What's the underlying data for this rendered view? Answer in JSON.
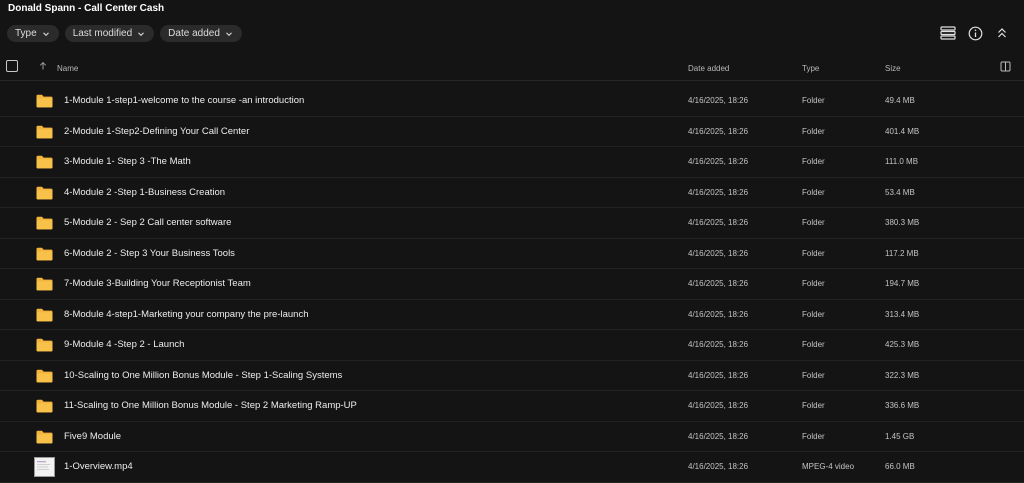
{
  "window": {
    "title": "Donald Spann - Call Center Cash"
  },
  "filters": [
    {
      "label": "Type"
    },
    {
      "label": "Last modified"
    },
    {
      "label": "Date added"
    }
  ],
  "toolbar": {
    "icons": [
      "list-view-icon",
      "info-icon",
      "collapse-icon"
    ]
  },
  "table": {
    "columns": {
      "name": "Name",
      "date": "Date added",
      "type": "Type",
      "size": "Size"
    },
    "sort": {
      "column": "name",
      "direction": "ascending"
    },
    "rows": [
      {
        "icon": "folder-icon",
        "name": "1-Module 1-step1-welcome to the course -an introduction",
        "date": "4/16/2025, 18:26",
        "type": "Folder",
        "size": "49.4 MB"
      },
      {
        "icon": "folder-icon",
        "name": "2-Module 1-Step2-Defining Your Call Center",
        "date": "4/16/2025, 18:26",
        "type": "Folder",
        "size": "401.4 MB"
      },
      {
        "icon": "folder-icon",
        "name": "3-Module 1- Step 3 -The Math",
        "date": "4/16/2025, 18:26",
        "type": "Folder",
        "size": "111.0 MB"
      },
      {
        "icon": "folder-icon",
        "name": "4-Module 2 -Step 1-Business Creation",
        "date": "4/16/2025, 18:26",
        "type": "Folder",
        "size": "53.4 MB"
      },
      {
        "icon": "folder-icon",
        "name": "5-Module 2 - Sep 2 Call center software",
        "date": "4/16/2025, 18:26",
        "type": "Folder",
        "size": "380.3 MB"
      },
      {
        "icon": "folder-icon",
        "name": "6-Module 2 - Step 3 Your Business Tools",
        "date": "4/16/2025, 18:26",
        "type": "Folder",
        "size": "117.2 MB"
      },
      {
        "icon": "folder-icon",
        "name": "7-Module 3-Building Your Receptionist Team",
        "date": "4/16/2025, 18:26",
        "type": "Folder",
        "size": "194.7 MB"
      },
      {
        "icon": "folder-icon",
        "name": "8-Module 4-step1-Marketing your company the pre-launch",
        "date": "4/16/2025, 18:26",
        "type": "Folder",
        "size": "313.4 MB"
      },
      {
        "icon": "folder-icon",
        "name": "9-Module 4 -Step 2 - Launch",
        "date": "4/16/2025, 18:26",
        "type": "Folder",
        "size": "425.3 MB"
      },
      {
        "icon": "folder-icon",
        "name": "10-Scaling to One Million Bonus Module - Step 1-Scaling Systems",
        "date": "4/16/2025, 18:26",
        "type": "Folder",
        "size": "322.3 MB"
      },
      {
        "icon": "folder-icon",
        "name": "11-Scaling to One Million Bonus Module - Step 2 Marketing Ramp-UP",
        "date": "4/16/2025, 18:26",
        "type": "Folder",
        "size": "336.6 MB"
      },
      {
        "icon": "folder-icon",
        "name": "Five9 Module",
        "date": "4/16/2025, 18:26",
        "type": "Folder",
        "size": "1.45 GB"
      },
      {
        "icon": "video-thumbnail",
        "name": "1-Overview.mp4",
        "date": "4/16/2025, 18:26",
        "type": "MPEG-4 video",
        "size": "66.0 MB"
      }
    ]
  },
  "colors": {
    "background": "#141414",
    "folder": "#f3b43c",
    "text": "#ededed"
  }
}
